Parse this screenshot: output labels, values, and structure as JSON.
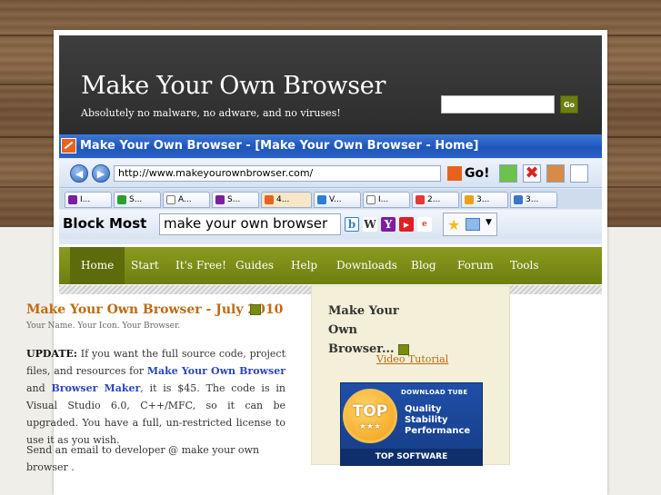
{
  "site": {
    "title": "Make Your Own Browser",
    "tagline": "Absolutely no malware, no adware, and no viruses!",
    "search_button": "Go"
  },
  "banner": {
    "window_title": "Make Your Own Browser - [Make Your Own Browser - Home]",
    "url": "http://www.makeyourownbrowser.com/",
    "go_label": "Go!",
    "tabs": [
      "I...",
      "S...",
      "A...",
      "S...",
      "4...",
      "V...",
      "I...",
      "2...",
      "3...",
      "3..."
    ],
    "block_label": "Block Most",
    "search_text": "make your own browser"
  },
  "nav": {
    "items": [
      "Home",
      "Start",
      "It's Free!",
      "Guides",
      "Help",
      "Downloads",
      "Blog",
      "Forum",
      "Tools"
    ]
  },
  "post": {
    "title": "Make Your Own Browser - July 2010",
    "subtitle": "Your Name. Your Icon. Your Browser.",
    "update_label": "UPDATE:",
    "text_1": " If you want the full source code, project files, and resources for ",
    "link_1": "Make Your Own Browser",
    "text_2": " and ",
    "link_2": "Browser Maker",
    "text_3": ", it is $45. The code is in Visual Studio 6.0, C++/MFC, so it can be upgraded. You have a full, un-restricted license to use it as you wish.",
    "para_2": "Send an email to developer @ make your own browser ."
  },
  "sidebar": {
    "title": "Make Your Own Browser...",
    "link": "Video Tutorial",
    "badge": {
      "seal": "TOP",
      "brand": "DOWNLOAD TUBE",
      "line_1": "Quality",
      "line_2": "Stability",
      "line_3": "Performance",
      "footer": "TOP SOFTWARE"
    }
  }
}
